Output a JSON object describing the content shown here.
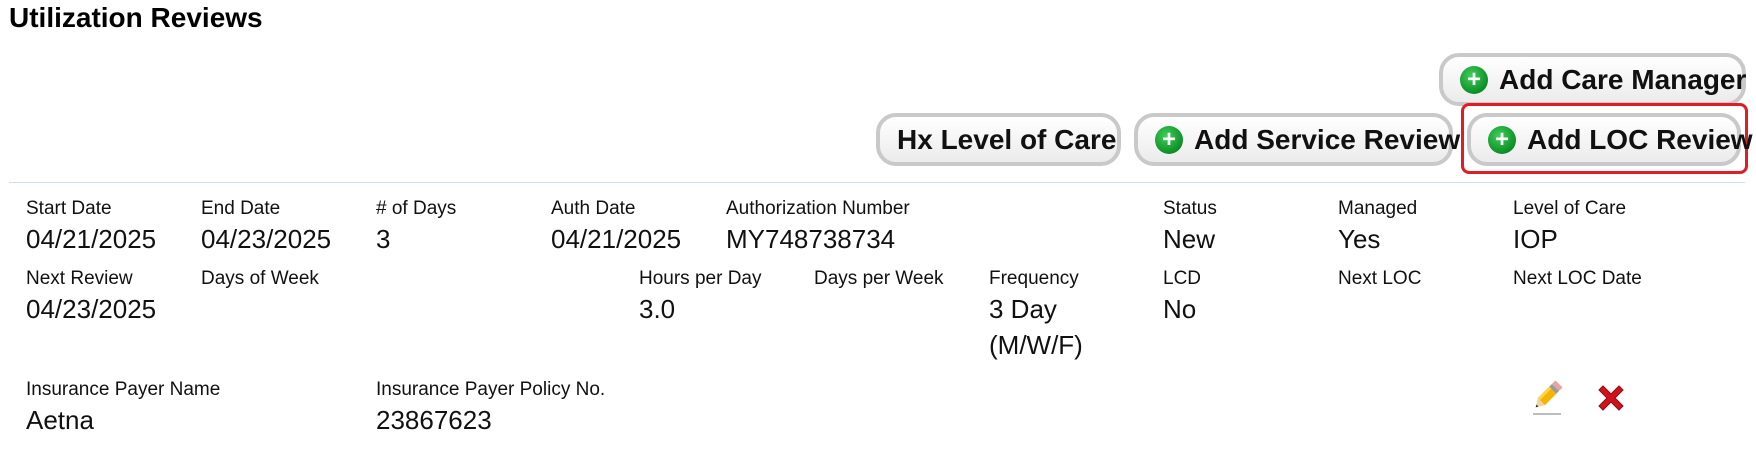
{
  "page": {
    "title": "Utilization Reviews"
  },
  "buttons": {
    "add_care_manager": "Add Care Manager",
    "hx_level_of_care": "Hx Level of Care",
    "add_service_review": "Add Service Review",
    "add_loc_review": "Add LOC Review"
  },
  "colors": {
    "highlight": "#e01d25",
    "plus_green": "#14a532",
    "delete_red": "#d0121c"
  },
  "review": {
    "start_date": {
      "label": "Start Date",
      "value": "04/21/2025"
    },
    "end_date": {
      "label": "End Date",
      "value": "04/23/2025"
    },
    "num_days": {
      "label": "# of Days",
      "value": "3"
    },
    "auth_date": {
      "label": "Auth Date",
      "value": "04/21/2025"
    },
    "authorization_number": {
      "label": "Authorization Number",
      "value": "MY748738734"
    },
    "status": {
      "label": "Status",
      "value": "New"
    },
    "managed": {
      "label": "Managed",
      "value": "Yes"
    },
    "level_of_care": {
      "label": "Level of Care",
      "value": "IOP"
    },
    "next_review": {
      "label": "Next Review",
      "value": "04/23/2025"
    },
    "days_of_week": {
      "label": "Days of Week",
      "value": ""
    },
    "hours_per_day": {
      "label": "Hours per Day",
      "value": "3.0"
    },
    "days_per_week": {
      "label": "Days per Week",
      "value": ""
    },
    "frequency": {
      "label": "Frequency",
      "value_line1": "3 Day",
      "value_line2": "(M/W/F)"
    },
    "lcd": {
      "label": "LCD",
      "value": "No"
    },
    "next_loc": {
      "label": "Next LOC",
      "value": ""
    },
    "next_loc_date": {
      "label": "Next LOC Date",
      "value": ""
    },
    "insurance_payer_name": {
      "label": "Insurance Payer Name",
      "value": "Aetna"
    },
    "insurance_payer_policy_no": {
      "label": "Insurance Payer Policy No.",
      "value": "23867623"
    }
  },
  "icons": {
    "edit": "pencil-icon",
    "delete": "x-delete-icon",
    "add": "plus-circle-icon"
  }
}
